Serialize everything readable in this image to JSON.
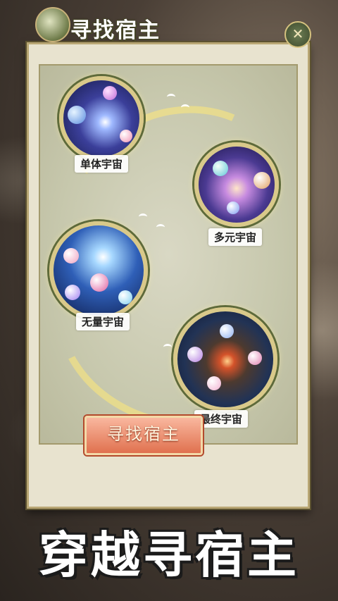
{
  "window": {
    "title": "寻找宿主"
  },
  "orbs": [
    {
      "label": "单体宇宙",
      "theme_color": "#6c8ae0"
    },
    {
      "label": "多元宇宙",
      "theme_color": "#8c6fd8"
    },
    {
      "label": "无量宇宙",
      "theme_color": "#4a85d6"
    },
    {
      "label": "最终宇宙",
      "theme_color": "#c25a3a"
    }
  ],
  "action": {
    "label": "寻找宿主"
  },
  "banner": {
    "text": "穿越寻宿主"
  },
  "colors": {
    "accent": "#e0714f",
    "panel": "#e8e3cf",
    "frame": "#b9a774"
  }
}
